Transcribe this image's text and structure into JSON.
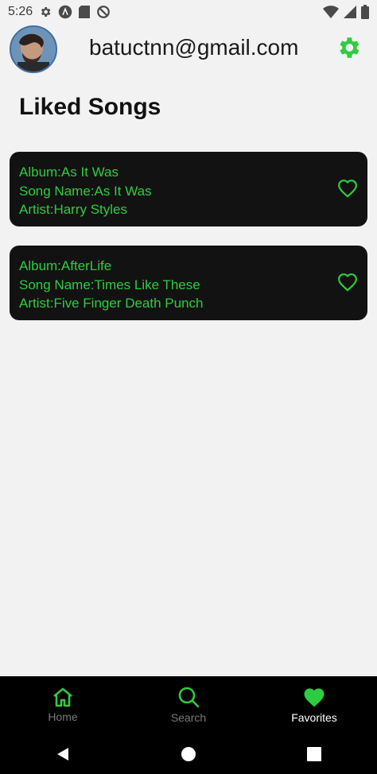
{
  "status_bar": {
    "time": "5:26",
    "left_icons": [
      "settings-gear-icon",
      "app-a-icon",
      "sd-card-icon",
      "do-not-disturb-icon"
    ],
    "right_icons": [
      "wifi-icon",
      "signal-icon",
      "battery-icon"
    ]
  },
  "header": {
    "email": "batuctnn@gmail.com",
    "accent_color": "#2ecc40"
  },
  "page": {
    "title": "Liked Songs"
  },
  "songs": [
    {
      "album": "Album:As It Was",
      "song_name": "Song Name:As It Was",
      "artist": "Artist:Harry Styles",
      "liked": true
    },
    {
      "album": "Album:AfterLife",
      "song_name": "Song Name:Times Like These",
      "artist": "Artist:Five Finger Death Punch",
      "liked": true
    }
  ],
  "bottom_nav": {
    "items": [
      {
        "label": "Home",
        "icon": "home-icon",
        "active": false
      },
      {
        "label": "Search",
        "icon": "search-icon",
        "active": false
      },
      {
        "label": "Favorites",
        "icon": "heart-icon",
        "active": true
      }
    ]
  },
  "system_nav": [
    "back-icon",
    "home-circle-icon",
    "recents-icon"
  ]
}
